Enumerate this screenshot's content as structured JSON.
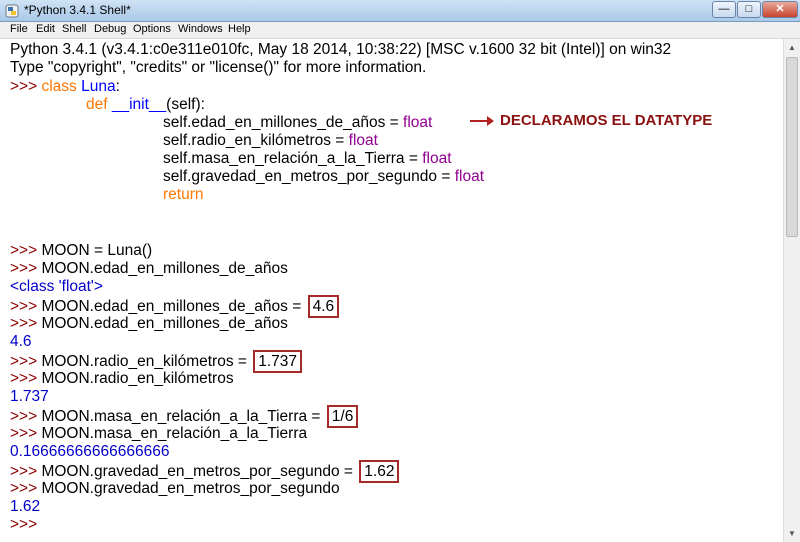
{
  "window": {
    "title": "*Python 3.4.1 Shell*"
  },
  "titlebar_buttons": {
    "minimize": "—",
    "maximize": "□",
    "close": "✕"
  },
  "menu": [
    "File",
    "Edit",
    "Shell",
    "Debug",
    "Options",
    "Windows",
    "Help"
  ],
  "shell": {
    "prompt": ">>>",
    "banner_1": "Python 3.4.1 (v3.4.1:c0e311e010fc, May 18 2014, 10:38:22) [MSC v.1600 32 bit (Intel)] on win32",
    "banner_2": "Type \"copyright\", \"credits\" or \"license()\" for more information.",
    "class_kw": "class",
    "class_name": "Luna",
    "class_colon": ":",
    "def_kw": "def",
    "def_name": "__init__",
    "def_args": "(self):",
    "attr_1": "self.edad_en_millones_de_años = ",
    "attr_2": "self.radio_en_kilómetros = ",
    "attr_3": "self.masa_en_relación_a_la_Tierra = ",
    "attr_4": "self.gravedad_en_metros_por_segundo = ",
    "float_word": "float",
    "return_kw": "return",
    "stmt_1": "MOON = Luna()",
    "stmt_2": "MOON.edad_en_millones_de_años",
    "out_class_float": "<class 'float'>",
    "stmt_3": "MOON.edad_en_millones_de_años = ",
    "val_3": "4.6",
    "stmt_4": "MOON.edad_en_millones_de_años",
    "out_4": "4.6",
    "stmt_5": "MOON.radio_en_kilómetros = ",
    "val_5": "1.737",
    "stmt_6": "MOON.radio_en_kilómetros",
    "out_6": "1.737",
    "stmt_7": "MOON.masa_en_relación_a_la_Tierra = ",
    "val_7": "1/6",
    "stmt_8": "MOON.masa_en_relación_a_la_Tierra",
    "out_8": "0.16666666666666666",
    "stmt_9": "MOON.gravedad_en_metros_por_segundo = ",
    "val_9": "1.62",
    "stmt_10": "MOON.gravedad_en_metros_por_segundo",
    "out_10": "1.62"
  },
  "annotation": {
    "text": "DECLARAMOS EL DATATYPE",
    "color": "#8b1010"
  },
  "colors": {
    "prompt": "#8b0000",
    "keyword": "#ff7700",
    "definition": "#0000ff",
    "builtin": "#900090",
    "output": "#0000cc",
    "highlight_box": "#a52a2a"
  },
  "icons": {
    "app": "python-idle-icon"
  }
}
